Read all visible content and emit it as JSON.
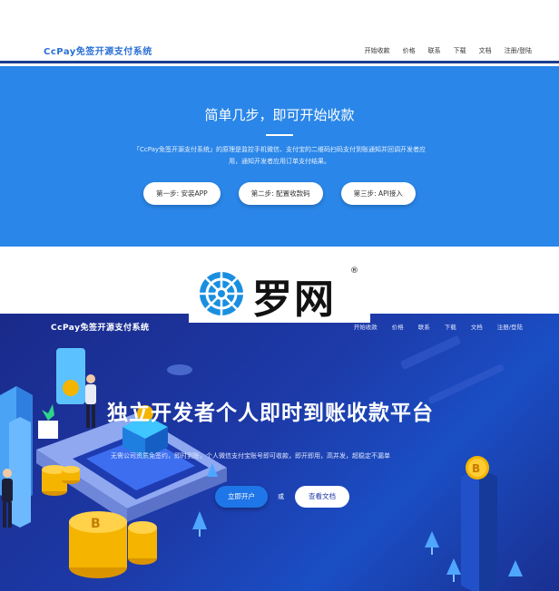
{
  "top": {
    "brand": "CcPay免签开源支付系统",
    "menu": [
      "开始收款",
      "价格",
      "联系",
      "下载",
      "文档",
      "注册/登陆"
    ],
    "title": "简单几步，即可开始收款",
    "desc": "「CcPay免签开源支付系统」的原理是监控手机微信、支付宝的二维码扫码支付到账通知并回调开发者应用，通知开发者应用订单支付结果。",
    "steps": [
      "第一步: 安装APP",
      "第二步: 配置收款码",
      "第三步: API接入"
    ]
  },
  "logo": {
    "text": "罗网",
    "reg": "®"
  },
  "bottom": {
    "brand": "CcPay免签开源支付系统",
    "menu": [
      "开始收款",
      "价格",
      "联系",
      "下载",
      "文档",
      "注册/登陆"
    ],
    "title": "独立开发者个人即时到账收款平台",
    "desc": "无需公司资质免签约，即时到账，个人微信支付宝账号即可收款，即开即用，高并发，超稳定不漏单",
    "btn_primary": "立即开户",
    "or": "或",
    "btn_secondary": "查看文档"
  },
  "colors": {
    "top_hero": "#2a86e8",
    "bottom_bg": "#1d3aa8",
    "brand_blue": "#2a6fd6",
    "coin": "#f4b400"
  }
}
